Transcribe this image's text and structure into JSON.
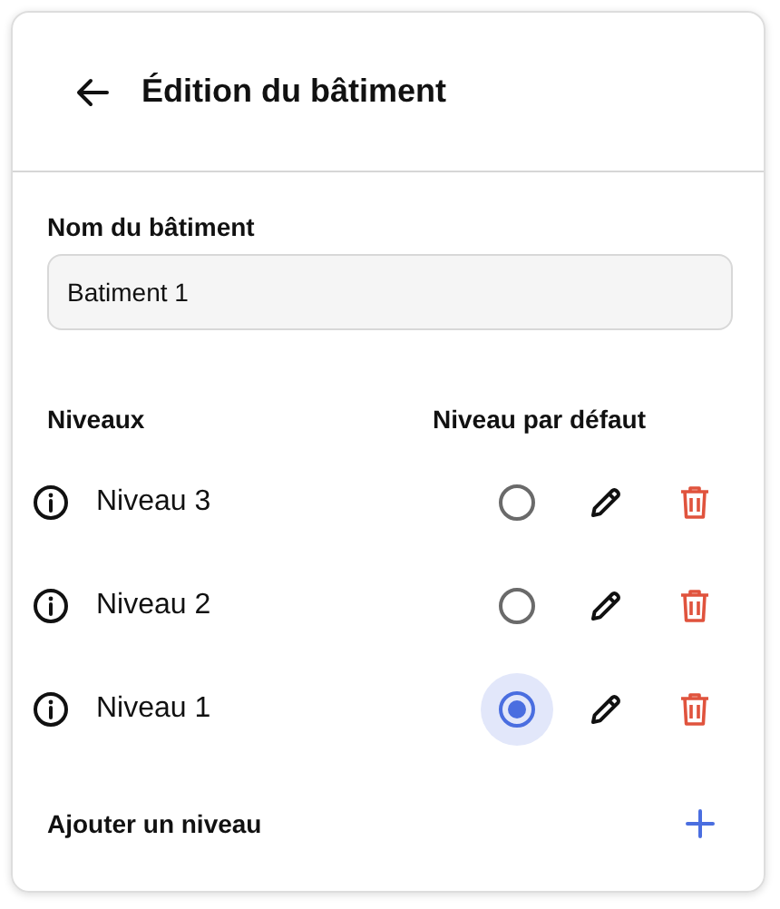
{
  "header": {
    "title": "Édition du bâtiment"
  },
  "building_name": {
    "label": "Nom du bâtiment",
    "value": "Batiment 1"
  },
  "levels_header": {
    "levels_label": "Niveaux",
    "default_label": "Niveau par défaut"
  },
  "levels": [
    {
      "name": "Niveau 3",
      "selected": false
    },
    {
      "name": "Niveau 2",
      "selected": false
    },
    {
      "name": "Niveau 1",
      "selected": true
    }
  ],
  "add_level": {
    "label": "Ajouter un niveau"
  }
}
